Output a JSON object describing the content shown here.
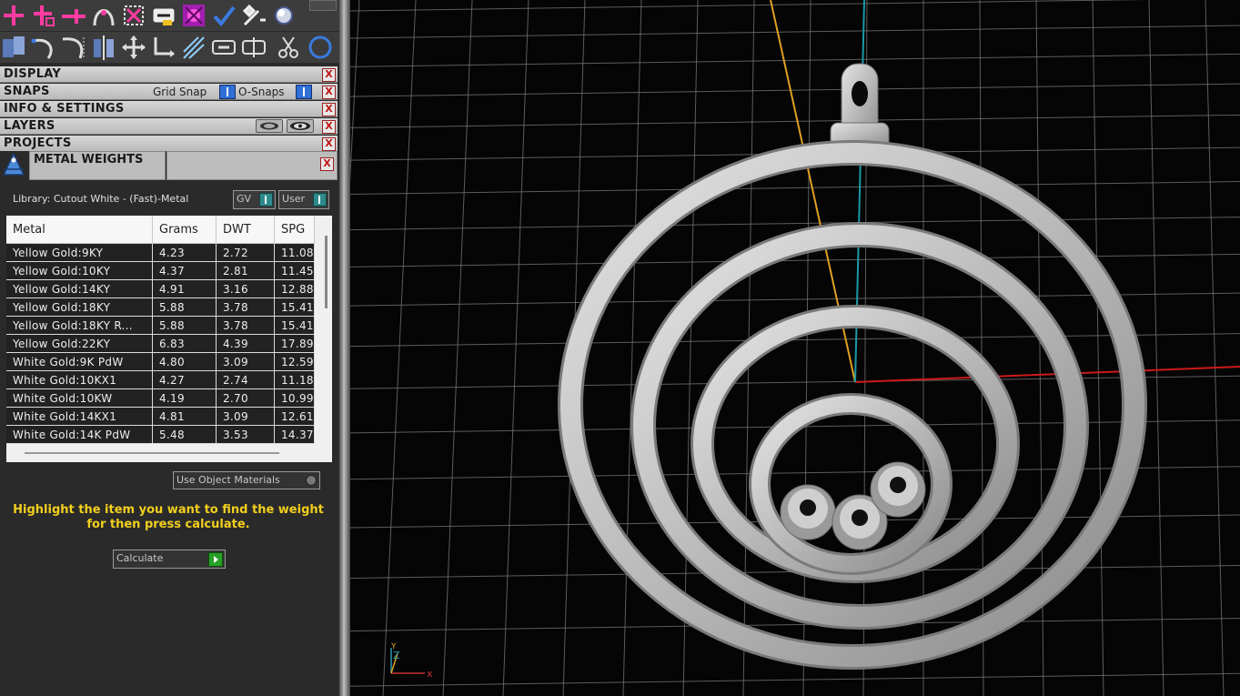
{
  "toolbar": {
    "row1": [
      "add-point-icon",
      "add-point-grid-icon",
      "add-point-line-icon",
      "curve-icon",
      "select-cross-icon",
      "chain-link-icon",
      "material-icon",
      "checkmark-icon",
      "tools-icon",
      "sphere-icon"
    ],
    "row2": [
      "solid-icon",
      "arc-icon",
      "bezier-icon",
      "mirror-icon",
      "move-icon",
      "path-icon",
      "sparkle-icon",
      "link-icon",
      "split-link-icon",
      "scissors-icon",
      "circle-icon"
    ]
  },
  "sections": {
    "display": "DISPLAY",
    "snaps": "SNAPS",
    "grid_snap": "Grid Snap",
    "o_snaps": "O-Snaps",
    "info": "INFO & SETTINGS",
    "layers": "LAYERS",
    "projects": "PROJECTS",
    "close_glyph": "X"
  },
  "metal_weights": {
    "title": "METAL WEIGHTS",
    "library": "Library: Cutout White - (Fast)-Metal",
    "gv_label": "GV",
    "user_label": "User",
    "columns": [
      "Metal",
      "Grams",
      "DWT",
      "SPG"
    ],
    "rows": [
      [
        "Yellow Gold:9KY",
        "4.23",
        "2.72",
        "11.08"
      ],
      [
        "Yellow Gold:10KY",
        "4.37",
        "2.81",
        "11.45"
      ],
      [
        "Yellow Gold:14KY",
        "4.91",
        "3.16",
        "12.88"
      ],
      [
        "Yellow Gold:18KY",
        "5.88",
        "3.78",
        "15.41"
      ],
      [
        "Yellow Gold:18KY R...",
        "5.88",
        "3.78",
        "15.41"
      ],
      [
        "Yellow Gold:22KY",
        "6.83",
        "4.39",
        "17.89"
      ],
      [
        "White Gold:9K PdW",
        "4.80",
        "3.09",
        "12.59"
      ],
      [
        "White Gold:10KX1",
        "4.27",
        "2.74",
        "11.18"
      ],
      [
        "White Gold:10KW",
        "4.19",
        "2.70",
        "10.99"
      ],
      [
        "White Gold:14KX1",
        "4.81",
        "3.09",
        "12.61"
      ],
      [
        "White Gold:14K PdW",
        "5.48",
        "3.53",
        "14.37"
      ]
    ],
    "use_object_materials": "Use Object Materials",
    "hint_line1": "Highlight the item you want to find the weight",
    "hint_line2": "for then press calculate.",
    "calculate": "Calculate"
  },
  "viewport": {
    "axis_x_label": "x",
    "axis_z_label": "Z",
    "axis_y_label": "Y",
    "colors": {
      "x_axis": "#cc1a1a",
      "y_axis": "#e0a020",
      "z_axis": "#1a9aa8",
      "grid": "#7a7a7a",
      "model": "#bdbdbd"
    }
  }
}
